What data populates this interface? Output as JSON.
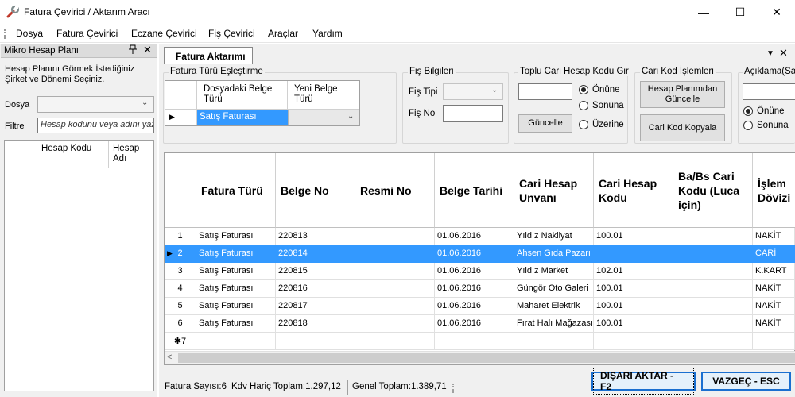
{
  "window": {
    "title": "Fatura Çevirici / Aktarım Aracı",
    "minimize": "—",
    "maximize": "☐",
    "close": "✕"
  },
  "menu": [
    "Dosya",
    "Fatura Çevirici",
    "Eczane Çevirici",
    "Fiş Çevirici",
    "Araçlar",
    "Yardım"
  ],
  "left_panel": {
    "title": "Mikro Hesap Planı",
    "pin": "📌",
    "close": "✕",
    "description": "Hesap Planını Görmek İstediğiniz Şirket ve Dönemi Seçiniz.",
    "dosya_label": "Dosya",
    "filtre_label": "Filtre",
    "filtre_placeholder": "Hesap kodunu veya adını yaz...",
    "grid_headers": [
      "Hesap Kodu",
      "Hesap Adı"
    ]
  },
  "tab": {
    "label": "Fatura Aktarımı"
  },
  "mapping": {
    "title": "Fatura Türü Eşleştirme",
    "headers": [
      "Dosyadaki Belge Türü",
      "Yeni Belge Türü"
    ],
    "row_value": "Satış Faturası"
  },
  "fis": {
    "title": "Fiş Bilgileri",
    "tip_label": "Fiş Tipi",
    "no_label": "Fiş No"
  },
  "toplu": {
    "title": "Toplu Cari Hesap Kodu Gir",
    "button": "Güncelle",
    "options": [
      "Önüne",
      "Sonuna",
      "Üzerine"
    ],
    "selected": 0
  },
  "cari_kod": {
    "title": "Cari Kod İşlemleri",
    "btn_update": "Hesap Planımdan Güncelle",
    "btn_copy": "Cari Kod Kopyala"
  },
  "aciklama": {
    "title": "Açıklama(Sat",
    "options": [
      "Önüne",
      "Sonuna"
    ],
    "selected": 0
  },
  "grid": {
    "headers": [
      "Fatura Türü",
      "Belge No",
      "Resmi No",
      "Belge Tarihi",
      "Cari Hesap Unvanı",
      "Cari Hesap Kodu",
      "Ba/Bs Cari Kodu (Luca için)",
      "İşlem Dövizi"
    ],
    "rows": [
      {
        "n": "1",
        "tur": "Satış Faturası",
        "belge": "220813",
        "resmi": "",
        "tarih": "01.06.2016",
        "unvan": "Yıldız Nakliyat",
        "kod": "100.01",
        "babs": "",
        "doviz": "NAKİT"
      },
      {
        "n": "2",
        "tur": "Satış Faturası",
        "belge": "220814",
        "resmi": "",
        "tarih": "01.06.2016",
        "unvan": "Ahsen Gıda Pazarı",
        "kod": "",
        "babs": "",
        "doviz": "CARİ"
      },
      {
        "n": "3",
        "tur": "Satış Faturası",
        "belge": "220815",
        "resmi": "",
        "tarih": "01.06.2016",
        "unvan": "Yıldız Market",
        "kod": "102.01",
        "babs": "",
        "doviz": "K.KART"
      },
      {
        "n": "4",
        "tur": "Satış Faturası",
        "belge": "220816",
        "resmi": "",
        "tarih": "01.06.2016",
        "unvan": "Güngör Oto Galeri",
        "kod": "100.01",
        "babs": "",
        "doviz": "NAKİT"
      },
      {
        "n": "5",
        "tur": "Satış Faturası",
        "belge": "220817",
        "resmi": "",
        "tarih": "01.06.2016",
        "unvan": "Maharet Elektrik",
        "kod": "100.01",
        "babs": "",
        "doviz": "NAKİT"
      },
      {
        "n": "6",
        "tur": "Satış Faturası",
        "belge": "220818",
        "resmi": "",
        "tarih": "01.06.2016",
        "unvan": "Fırat Halı Mağazası",
        "kod": "100.01",
        "babs": "",
        "doviz": "NAKİT"
      }
    ],
    "new_row": "7",
    "selected_row": 1
  },
  "status": {
    "fatura_sayisi": "Fatura Sayısı:6",
    "kdv_haric": "Kdv Hariç Toplam:1.297,12",
    "genel_toplam": "Genel Toplam:1.389,71"
  },
  "actions": {
    "export": "DIŞARI AKTAR - F2",
    "cancel": "VAZGEÇ - ESC"
  },
  "colors": {
    "selection": "#3399ff",
    "accent_border": "#1a6fd0"
  }
}
